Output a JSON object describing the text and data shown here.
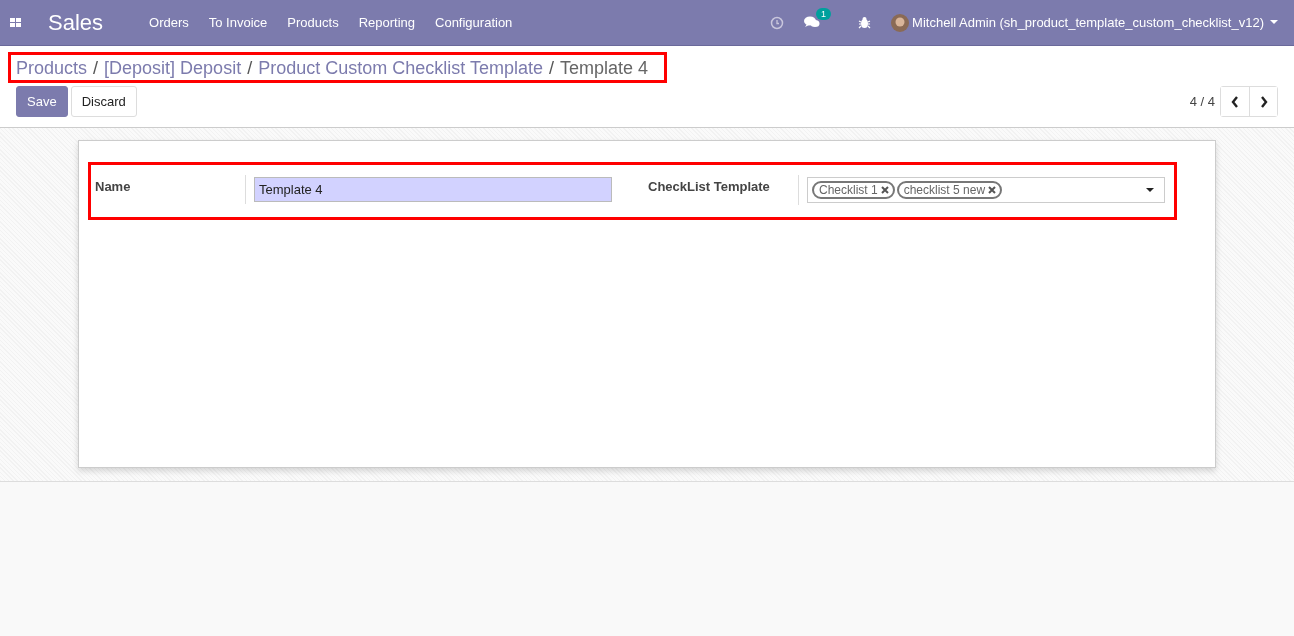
{
  "navbar": {
    "app_title": "Sales",
    "menu": [
      "Orders",
      "To Invoice",
      "Products",
      "Reporting",
      "Configuration"
    ],
    "messages_badge": "1",
    "user": "Mitchell Admin (sh_product_template_custom_checklist_v12)"
  },
  "breadcrumbs": [
    {
      "label": "Products",
      "kind": "link"
    },
    {
      "label": "[Deposit] Deposit",
      "kind": "link"
    },
    {
      "label": "Product Custom Checklist Template",
      "kind": "link"
    },
    {
      "label": "Template 4",
      "kind": "current"
    }
  ],
  "breadcrumb_separator": "/",
  "buttons": [
    {
      "label": "Save",
      "kind": "primary"
    },
    {
      "label": "Discard",
      "kind": "secondary"
    }
  ],
  "pager": "4 / 4",
  "form": {
    "name_label": "Name",
    "name_value": "Template 4",
    "checklist_label": "CheckList Template",
    "tags": [
      "Checklist 1",
      "checklist 5 new"
    ]
  }
}
